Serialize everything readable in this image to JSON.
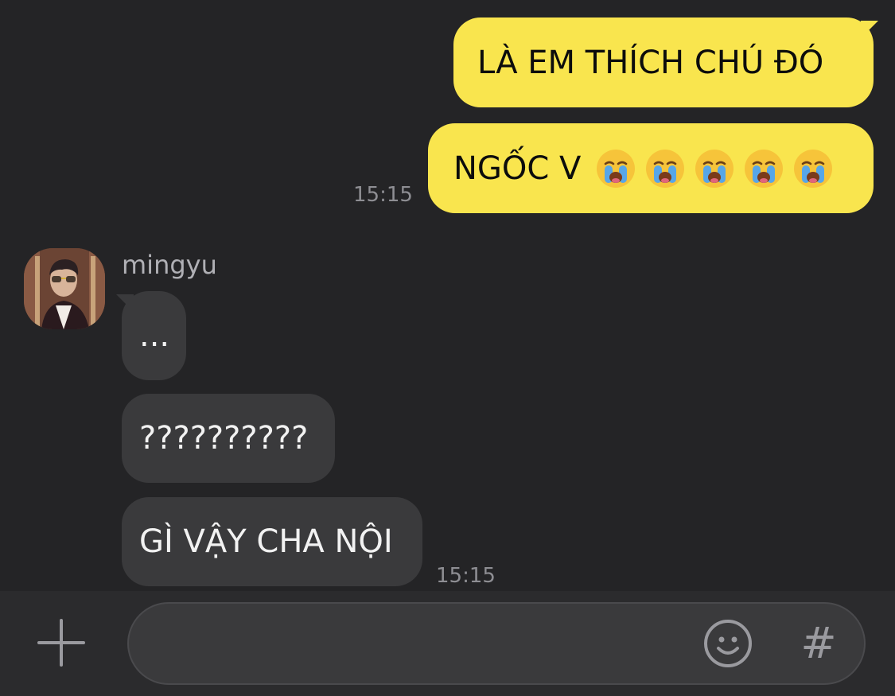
{
  "chat": {
    "outgoing": [
      {
        "text": "LÀ EM THÍCH CHÚ ĐÓ"
      },
      {
        "text": "NGỐC V"
      }
    ],
    "outgoing_time": "15:15",
    "incoming_sender": "mingyu",
    "incoming": [
      {
        "text": "..."
      },
      {
        "text": "??????????"
      },
      {
        "text": "GÌ VẬY CHA NỘI"
      }
    ],
    "incoming_time": "15:15",
    "emoji_name": "loudly-crying-face-icon",
    "emoji_count": 5
  },
  "composer": {
    "add_icon": "plus-icon",
    "emoji_icon": "smile-icon",
    "hashtag_icon": "hashtag-icon",
    "hashtag_symbol": "#"
  },
  "colors": {
    "background": "#242426",
    "outgoing_bubble": "#f9e54e",
    "incoming_bubble": "#3a3a3c",
    "timestamp": "#8e8e93"
  }
}
